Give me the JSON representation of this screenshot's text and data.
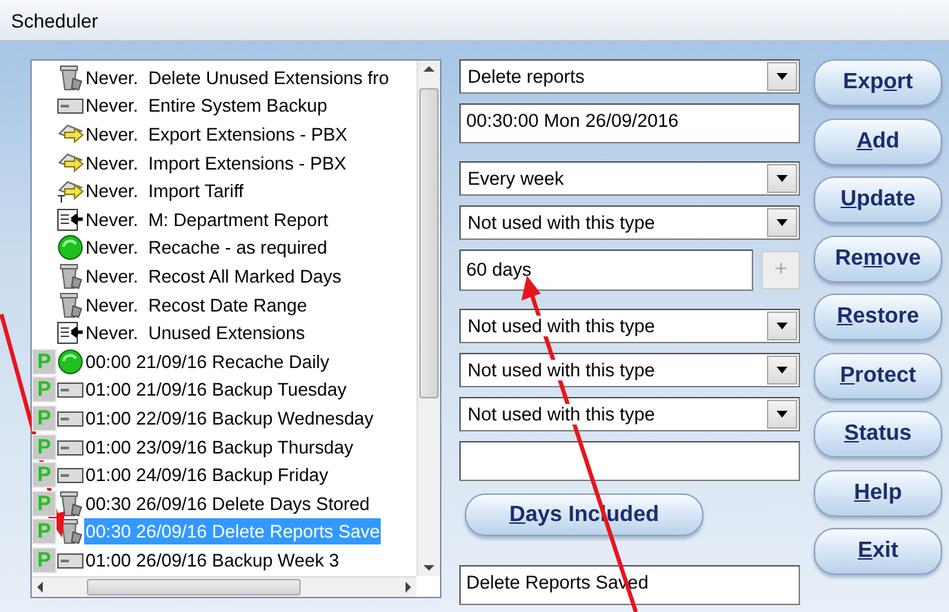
{
  "window": {
    "title": "Scheduler"
  },
  "schedule_list": {
    "items": [
      {
        "kind": "bin",
        "protected": false,
        "text": "Never.  Delete Unused Extensions fro",
        "selected": false
      },
      {
        "kind": "drive",
        "protected": false,
        "text": "Never.  Entire System Backup",
        "selected": false
      },
      {
        "kind": "export",
        "protected": false,
        "text": "Never.  Export Extensions - PBX",
        "selected": false
      },
      {
        "kind": "export",
        "protected": false,
        "text": "Never.  Import Extensions - PBX",
        "selected": false
      },
      {
        "kind": "tariff",
        "protected": false,
        "text": "Never.  Import Tariff",
        "selected": false
      },
      {
        "kind": "report",
        "protected": false,
        "text": "Never.  M: Department Report",
        "selected": false
      },
      {
        "kind": "recache",
        "protected": false,
        "text": "Never.  Recache - as required",
        "selected": false
      },
      {
        "kind": "bin",
        "protected": false,
        "text": "Never.  Recost All Marked Days",
        "selected": false
      },
      {
        "kind": "bin",
        "protected": false,
        "text": "Never.  Recost Date Range",
        "selected": false
      },
      {
        "kind": "report",
        "protected": false,
        "text": "Never.  Unused Extensions",
        "selected": false
      },
      {
        "kind": "recache",
        "protected": true,
        "mark": "P",
        "text": "00:00 21/09/16 Recache Daily",
        "selected": false
      },
      {
        "kind": "drive",
        "protected": true,
        "mark": "P",
        "text": "01:00 21/09/16 Backup Tuesday",
        "selected": false
      },
      {
        "kind": "drive",
        "protected": true,
        "mark": "P",
        "text": "01:00 22/09/16 Backup Wednesday",
        "selected": false
      },
      {
        "kind": "drive",
        "protected": true,
        "mark": "P",
        "text": "01:00 23/09/16 Backup Thursday",
        "selected": false
      },
      {
        "kind": "drive",
        "protected": true,
        "mark": "P",
        "text": "01:00 24/09/16 Backup Friday",
        "selected": false
      },
      {
        "kind": "bin",
        "protected": true,
        "mark": "P",
        "text": "00:30 26/09/16 Delete Days Stored",
        "selected": false
      },
      {
        "kind": "bin",
        "protected": true,
        "mark": "P",
        "text": "00:30 26/09/16 Delete Reports Save",
        "selected": true
      },
      {
        "kind": "drive",
        "protected": true,
        "mark": "P",
        "text": "01:00 26/09/16 Backup Week 3",
        "selected": false
      }
    ]
  },
  "fields": [
    {
      "kind": "combo",
      "value": "Delete reports"
    },
    {
      "kind": "text",
      "value": "00:30:00 Mon 26/09/2016"
    },
    {
      "kind": "combo",
      "value": "Every week"
    },
    {
      "kind": "combo",
      "value": "Not used with this type"
    },
    {
      "kind": "spin",
      "value": "60 days",
      "spin_label": "+",
      "spin_enabled": false
    },
    {
      "kind": "combo",
      "value": "Not used with this type"
    },
    {
      "kind": "combo",
      "value": "Not used with this type"
    },
    {
      "kind": "combo",
      "value": "Not used with this type"
    },
    {
      "kind": "text"
    },
    {
      "kind": "button",
      "label": {
        "key": "D",
        "after": "ays Included"
      }
    },
    {
      "kind": "text",
      "value": "Delete Reports Saved"
    }
  ],
  "buttons": [
    {
      "before": "Exp",
      "key": "o",
      "after": "rt"
    },
    {
      "key": "A",
      "after": "dd"
    },
    {
      "key": "U",
      "after": "pdate"
    },
    {
      "before": "Re",
      "key": "m",
      "after": "ove"
    },
    {
      "key": "R",
      "after": "estore"
    },
    {
      "key": "P",
      "after": "rotect"
    },
    {
      "key": "S",
      "after": "tatus"
    },
    {
      "key": "H",
      "after": "elp"
    },
    {
      "key": "E",
      "after": "xit"
    }
  ]
}
